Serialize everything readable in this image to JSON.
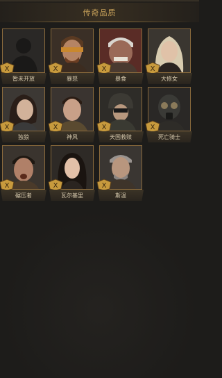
{
  "header": {
    "title": "传奇品质"
  },
  "heroes": [
    {
      "name": "暂未开放",
      "icon": "locked-silhouette-icon",
      "badge": "X"
    },
    {
      "name": "暴怒",
      "icon": "rage-hero-portrait",
      "badge": "X"
    },
    {
      "name": "暴食",
      "icon": "gluttony-hero-portrait",
      "badge": "X"
    },
    {
      "name": "大修女",
      "icon": "grand-nun-hero-portrait",
      "badge": "X"
    },
    {
      "name": "独狼",
      "icon": "lone-wolf-hero-portrait",
      "badge": "X"
    },
    {
      "name": "神风",
      "icon": "kamikaze-hero-portrait",
      "badge": "X"
    },
    {
      "name": "天国救赎",
      "icon": "heavenly-redemption-hero-portrait",
      "badge": "X"
    },
    {
      "name": "死亡骑士",
      "icon": "death-knight-hero-portrait",
      "badge": "X"
    },
    {
      "name": "碾压者",
      "icon": "crusher-hero-portrait",
      "badge": "X"
    },
    {
      "name": "瓦尔基里",
      "icon": "valkyrie-hero-portrait",
      "badge": "X"
    },
    {
      "name": "斯温",
      "icon": "sven-hero-portrait",
      "badge": "X"
    }
  ],
  "colors": {
    "frame": "#8a6a3c",
    "title": "#c9a25a",
    "badge": "#c79a3d"
  }
}
